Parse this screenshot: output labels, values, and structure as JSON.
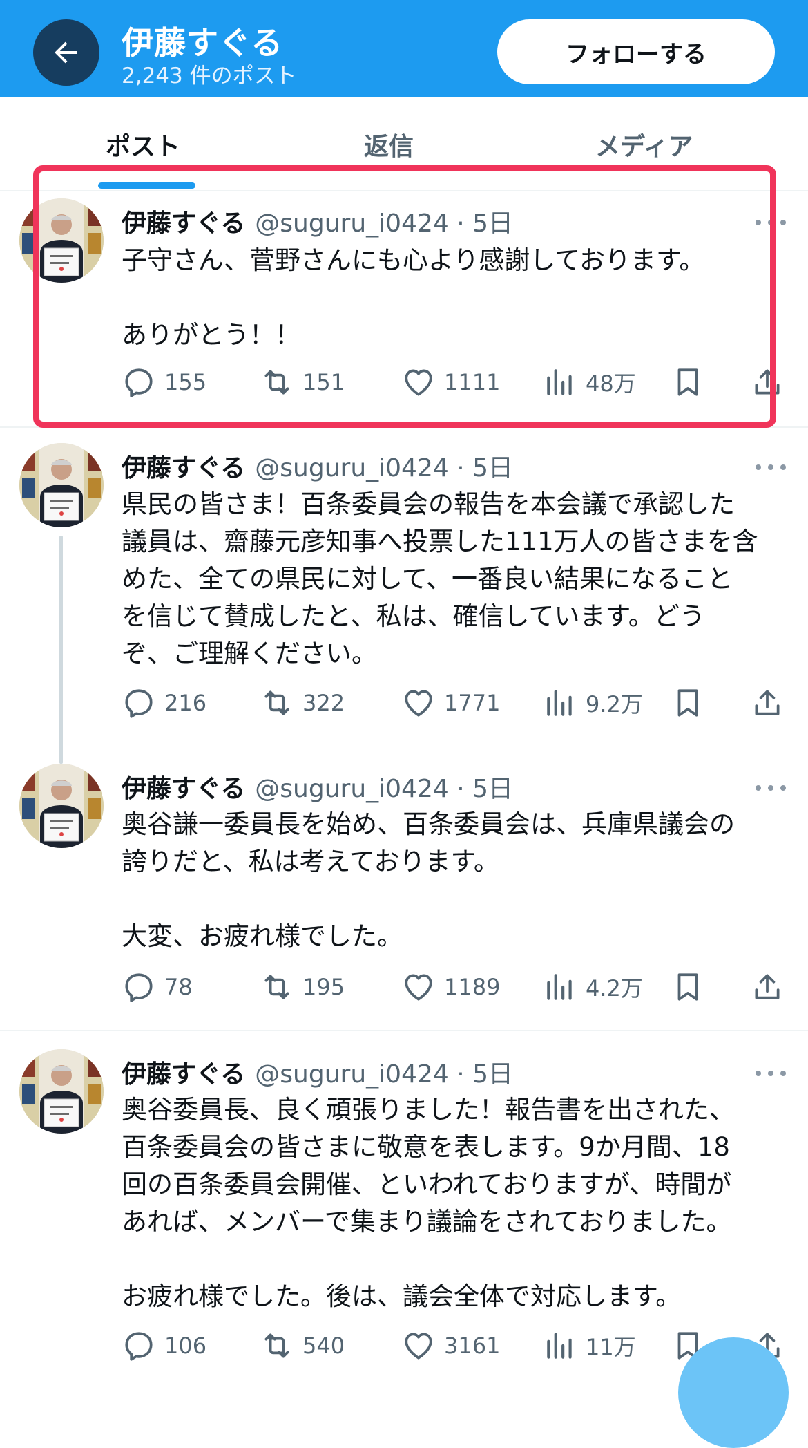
{
  "header": {
    "name": "伊藤すぐる",
    "post_count": "2,243 件のポスト",
    "follow_label": "フォローする",
    "background": "#1d9bf0"
  },
  "tabs": [
    {
      "label": "ポスト",
      "active": true
    },
    {
      "label": "返信",
      "active": false
    },
    {
      "label": "メディア",
      "active": false
    }
  ],
  "posts": [
    {
      "name": "伊藤すぐる",
      "handle": "@suguru_i0424 · 5日",
      "text": "子守さん、菅野さんにも心より感謝しております。\n\nありがとう！！",
      "replies": "155",
      "reposts": "151",
      "likes": "1111",
      "views": "48万",
      "highlighted": true
    },
    {
      "name": "伊藤すぐる",
      "handle": "@suguru_i0424 · 5日",
      "text": "県民の皆さま！百条委員会の報告を本会議で承認した\n議員は、齋藤元彦知事へ投票した111万人の皆さまを含\nめた、全ての県民に対して、一番良い結果になること\nを信じて賛成したと、私は、確信しています。どう\nぞ、ご理解ください。",
      "replies": "216",
      "reposts": "322",
      "likes": "1771",
      "views": "9.2万"
    },
    {
      "name": "伊藤すぐる",
      "handle": "@suguru_i0424 · 5日",
      "text": "奥谷謙一委員長を始め、百条委員会は、兵庫県議会の\n誇りだと、私は考えております。\n\n大変、お疲れ様でした。",
      "replies": "78",
      "reposts": "195",
      "likes": "1189",
      "views": "4.2万"
    },
    {
      "name": "伊藤すぐる",
      "handle": "@suguru_i0424 · 5日",
      "text": "奥谷委員長、良く頑張りました！報告書を出された、\n百条委員会の皆さまに敬意を表します。9か月間、18\n回の百条委員会開催、といわれておりますが、時間が\nあれば、メンバーで集まり議論をされておりました。\n\nお疲れ様でした。後は、議会全体で対応します。",
      "replies": "106",
      "reposts": "540",
      "likes": "3161",
      "views": "11万"
    }
  ],
  "colors": {
    "accent": "#1d9bf0",
    "highlight": "#f0345a",
    "secondary_text": "#536471"
  }
}
